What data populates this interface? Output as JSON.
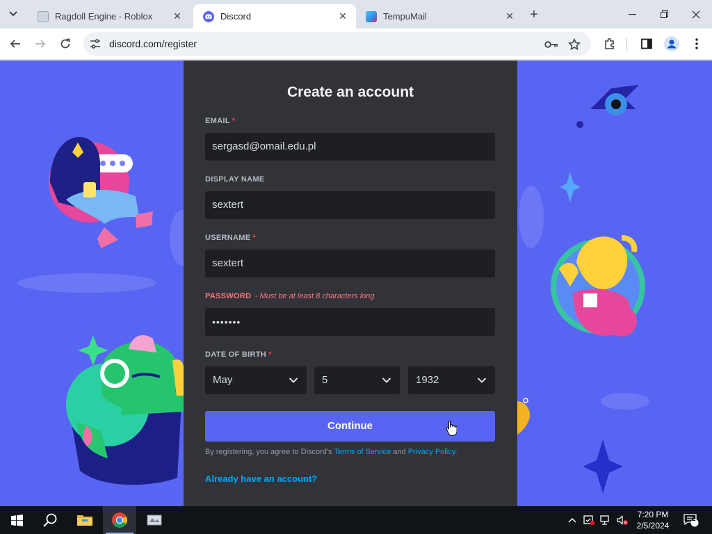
{
  "browser": {
    "tabs": [
      {
        "title": "Ragdoll Engine - Roblox",
        "active": false
      },
      {
        "title": "Discord",
        "active": true
      },
      {
        "title": "TempuMail",
        "active": false
      }
    ],
    "url": "discord.com/register"
  },
  "form": {
    "title": "Create an account",
    "email": {
      "label": "EMAIL",
      "required_mark": "*",
      "value": "sergasd@omail.edu.pl"
    },
    "display_name": {
      "label": "DISPLAY NAME",
      "value": "sextert"
    },
    "username": {
      "label": "USERNAME",
      "required_mark": "*",
      "value": "sextert"
    },
    "password": {
      "label": "PASSWORD",
      "error": "- Must be at least 8 characters long",
      "value": "•••••••"
    },
    "dob": {
      "label": "DATE OF BIRTH",
      "required_mark": "*",
      "month": "May",
      "day": "5",
      "year": "1932"
    },
    "continue_label": "Continue",
    "legal": {
      "prefix": "By registering, you agree to Discord's ",
      "terms": "Terms of Service",
      "middle": " and ",
      "privacy": "Privacy Policy",
      "suffix": "."
    },
    "login_link": "Already have an account?"
  },
  "taskbar": {
    "time": "7:20 PM",
    "date": "2/5/2024",
    "notification_count": "2"
  },
  "colors": {
    "discord_blurple": "#5865f2",
    "panel": "#313338",
    "input": "#1e1f22",
    "error": "#fa777c",
    "link": "#00a8fc"
  }
}
